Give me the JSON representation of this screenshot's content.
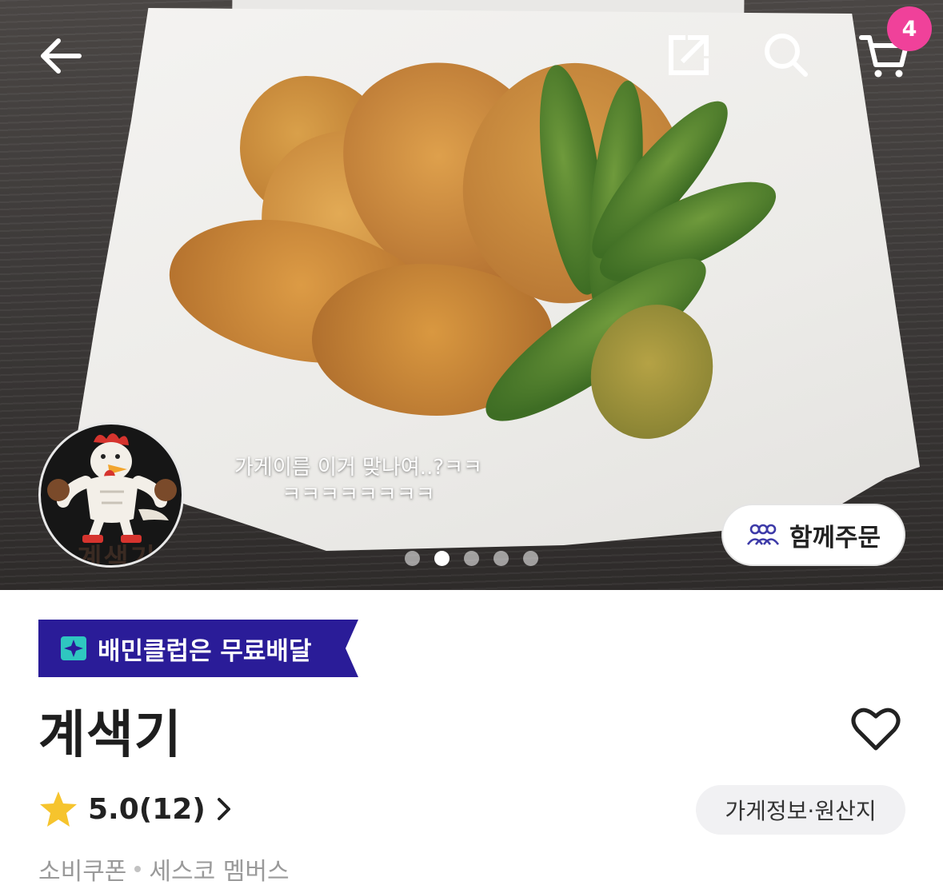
{
  "hero": {
    "caption_line1": "가게이름 이거 맞나여..?ㅋㅋ",
    "caption_line2": "ㅋㅋㅋㅋㅋㅋㅋㅋ",
    "logo_text": "계색기",
    "carousel": {
      "total": 5,
      "active_index": 1
    }
  },
  "toolbar": {
    "cart_badge": "4",
    "icons": [
      "back-arrow-icon",
      "share-icon",
      "search-icon",
      "cart-icon"
    ]
  },
  "group_order": {
    "label": "함께주문",
    "icon": "people-icon"
  },
  "club_banner": {
    "label": "배민클럽은 무료배달",
    "color": "#2a1c98"
  },
  "store": {
    "name": "계색기",
    "rating": "5.0(12)",
    "info_button": "가게정보·원산지",
    "tags": [
      "소비쿠폰",
      "세스코 멤버스"
    ]
  },
  "colors": {
    "badge": "#f0419a",
    "banner": "#2a1c98",
    "star": "#f6c42d"
  }
}
